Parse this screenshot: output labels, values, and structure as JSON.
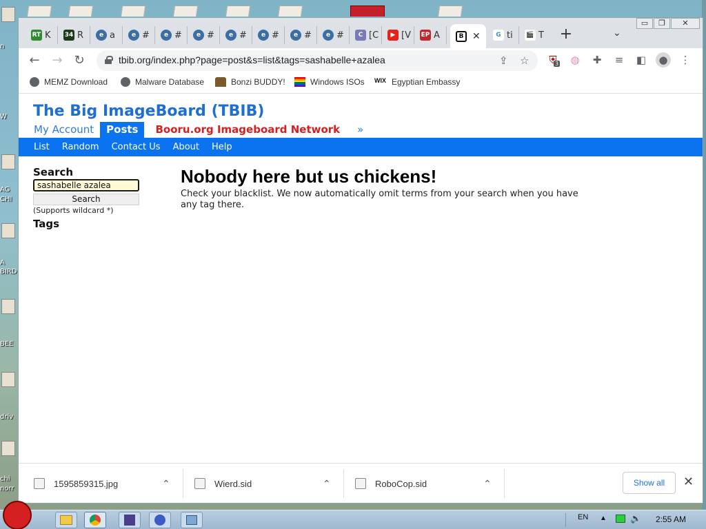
{
  "desktop": {
    "left_labels": [
      "n",
      "W",
      "AG",
      "CHI",
      "A",
      "BIRD",
      "BEE",
      "driv",
      "chi",
      "norr"
    ]
  },
  "window": {
    "tabs": [
      {
        "label": "K",
        "favicon_text": "RT",
        "favicon_color": "#2e8b2e"
      },
      {
        "label": "R",
        "favicon_text": "34",
        "favicon_color": "#1a3a1a"
      },
      {
        "label": "a",
        "favicon_text": "e",
        "favicon_color": "#3a6ea5"
      },
      {
        "label": "#",
        "favicon_text": "e",
        "favicon_color": "#3a6ea5"
      },
      {
        "label": "#",
        "favicon_text": "e",
        "favicon_color": "#3a6ea5"
      },
      {
        "label": "#",
        "favicon_text": "e",
        "favicon_color": "#3a6ea5"
      },
      {
        "label": "#",
        "favicon_text": "e",
        "favicon_color": "#3a6ea5"
      },
      {
        "label": "#",
        "favicon_text": "e",
        "favicon_color": "#3a6ea5"
      },
      {
        "label": "#",
        "favicon_text": "e",
        "favicon_color": "#3a6ea5"
      },
      {
        "label": "#",
        "favicon_text": "e",
        "favicon_color": "#3a6ea5"
      },
      {
        "label": "[C",
        "favicon_text": "C",
        "favicon_color": "#7a7ab8"
      },
      {
        "label": "[V",
        "favicon_text": "▶",
        "favicon_color": "#e62117"
      },
      {
        "label": "A",
        "favicon_text": "EP",
        "favicon_color": "#c0282d"
      },
      {
        "label": "",
        "favicon_text": "B",
        "favicon_color": "#111111"
      },
      {
        "label": "ti",
        "favicon_text": "G",
        "favicon_color": "#4285f4"
      },
      {
        "label": "T",
        "favicon_text": "🎬",
        "favicon_color": "#666666"
      }
    ],
    "active_tab_index": 13,
    "new_tab_label": "+",
    "url": "tbib.org/index.php?page=post&s=list&tags=sashabelle+azalea",
    "extension_badge": "3",
    "bookmarks": [
      {
        "label": "MEMZ Download",
        "icon": "globe-icon"
      },
      {
        "label": "Malware Database",
        "icon": "globe-icon"
      },
      {
        "label": "Bonzi BUDDY!",
        "icon": "bonzi-icon"
      },
      {
        "label": "Windows ISOs",
        "icon": "rainbow-flag-icon"
      },
      {
        "label": "Egyptian Embassy",
        "icon": "wix-icon"
      }
    ]
  },
  "site": {
    "title": "The Big ImageBoard (TBIB)",
    "nav_primary": [
      {
        "label": "My Account",
        "current": false
      },
      {
        "label": "Posts",
        "current": true
      },
      {
        "label": "Booru.org Imageboard Network",
        "current": false
      },
      {
        "label": "»",
        "current": false
      }
    ],
    "nav_secondary": [
      "List",
      "Random",
      "Contact Us",
      "About",
      "Help"
    ],
    "accent_color": "#0b72f0"
  },
  "sidebar": {
    "search_heading": "Search",
    "search_value": "sashabelle azalea",
    "search_button": "Search",
    "hint": "(Supports wildcard *)",
    "tags_heading": "Tags"
  },
  "main": {
    "heading": "Nobody here but us chickens!",
    "message": "Check your blacklist. We now automatically omit terms from your search when you have any tag there."
  },
  "downloads": {
    "items": [
      {
        "name": "1595859315.jpg"
      },
      {
        "name": "Wierd.sid"
      },
      {
        "name": "RoboCop.sid"
      }
    ],
    "show_all": "Show all",
    "close": "✕"
  },
  "taskbar": {
    "language": "EN",
    "time": "2:55 AM"
  }
}
